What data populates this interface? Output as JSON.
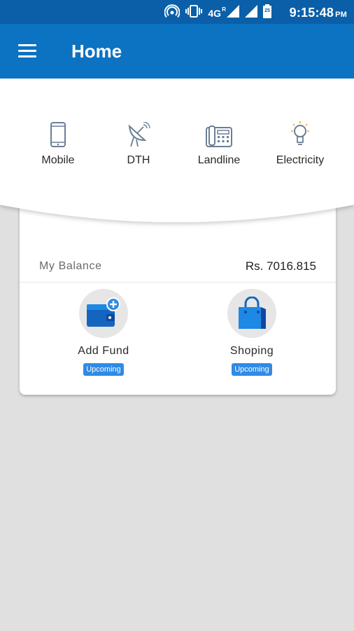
{
  "status_bar": {
    "network": "4G",
    "network_sup": "R",
    "battery_level": "25",
    "time": "9:15:48",
    "ampm": "PM"
  },
  "app_bar": {
    "title": "Home"
  },
  "services": [
    {
      "label": "Mobile",
      "icon": "mobile-phone-icon"
    },
    {
      "label": "DTH",
      "icon": "satellite-dish-icon"
    },
    {
      "label": "Landline",
      "icon": "landline-phone-icon"
    },
    {
      "label": "Electricity",
      "icon": "light-bulb-icon"
    }
  ],
  "balance": {
    "label": "My Balance",
    "value": "Rs. 7016.815"
  },
  "actions": [
    {
      "label": "Add Fund",
      "badge": "Upcoming",
      "icon": "wallet-add-icon"
    },
    {
      "label": "Shoping",
      "badge": "Upcoming",
      "icon": "shopping-bag-icon"
    }
  ],
  "colors": {
    "status_bar": "#0a5fa8",
    "app_bar": "#0c72c2",
    "accent": "#2f8be6",
    "background": "#e0e0e0"
  }
}
